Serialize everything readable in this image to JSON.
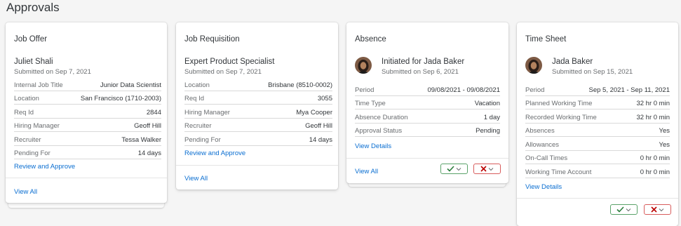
{
  "page": {
    "title": "Approvals"
  },
  "cards": {
    "job_offer": {
      "title": "Job Offer",
      "name": "Juliet Shali",
      "submitted": "Submitted on Sep 7, 2021",
      "rows": [
        {
          "label": "Internal Job Title",
          "value": "Junior Data Scientist"
        },
        {
          "label": "Location",
          "value": "San Francisco (1710-2003)"
        },
        {
          "label": "Req Id",
          "value": "2844"
        },
        {
          "label": "Hiring Manager",
          "value": "Geoff Hill"
        },
        {
          "label": "Recruiter",
          "value": "Tessa Walker"
        },
        {
          "label": "Pending For",
          "value": "14 days"
        }
      ],
      "link": "Review and Approve",
      "footer": "View All"
    },
    "job_requisition": {
      "title": "Job Requisition",
      "name": "Expert Product Specialist",
      "submitted": "Submitted on Sep 7, 2021",
      "rows": [
        {
          "label": "Location",
          "value": "Brisbane (8510-0002)"
        },
        {
          "label": "Req Id",
          "value": "3055"
        },
        {
          "label": "Hiring Manager",
          "value": "Mya Cooper"
        },
        {
          "label": "Recruiter",
          "value": "Geoff Hill"
        },
        {
          "label": "Pending For",
          "value": "14 days"
        }
      ],
      "link": "Review and Approve",
      "footer": "View All"
    },
    "absence": {
      "title": "Absence",
      "name": "Initiated for Jada Baker",
      "submitted": "Submitted on Sep 6, 2021",
      "rows": [
        {
          "label": "Period",
          "value": "09/08/2021 - 09/08/2021"
        },
        {
          "label": "Time Type",
          "value": "Vacation"
        },
        {
          "label": "Absence Duration",
          "value": "1 day"
        },
        {
          "label": "Approval Status",
          "value": "Pending"
        }
      ],
      "link": "View Details",
      "footer": "View All"
    },
    "time_sheet": {
      "title": "Time Sheet",
      "name": "Jada Baker",
      "submitted": "Submitted on Sep 15, 2021",
      "rows": [
        {
          "label": "Period",
          "value": "Sep 5, 2021 - Sep 11, 2021"
        },
        {
          "label": "Planned Working Time",
          "value": "32 hr 0 min"
        },
        {
          "label": "Recorded Working Time",
          "value": "32 hr 0 min"
        },
        {
          "label": "Absences",
          "value": "Yes"
        },
        {
          "label": "Allowances",
          "value": "Yes"
        },
        {
          "label": "On-Call Times",
          "value": "0 hr 0 min"
        },
        {
          "label": "Working Time Account",
          "value": "0 hr 0 min"
        }
      ],
      "link": "View Details"
    }
  },
  "colors": {
    "approve": "#2b7d3c",
    "reject": "#bb0000",
    "link": "#0a6ed1"
  },
  "icons": [
    "checkmark-icon",
    "cross-icon",
    "chevron-down-icon",
    "avatar"
  ]
}
